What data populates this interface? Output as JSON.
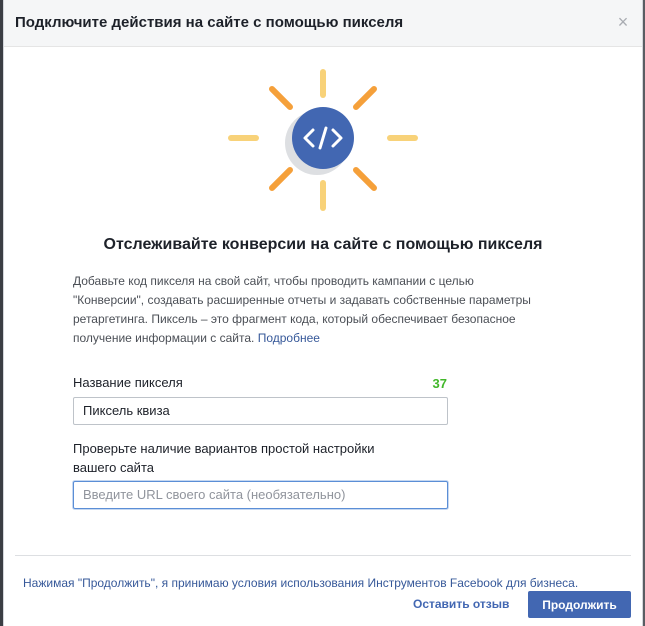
{
  "dialog": {
    "title": "Подключите действия на сайте с помощью пикселя",
    "close_glyph": "×"
  },
  "hero": {
    "icon": "code-icon",
    "icon_glyph": "</>",
    "colors": {
      "badge": "#4267b2",
      "badge_shadow": "#dddfe2",
      "ray_orange": "#f5a03a",
      "ray_yellow": "#f8d279"
    }
  },
  "main": {
    "heading": "Отслеживайте конверсии на сайте с помощью пикселя",
    "description_line1": "Добавьте код пикселя на свой сайт, чтобы проводить кампании с целью",
    "description_line2": "\"Конверсии\", создавать расширенные отчеты и задавать собственные параметры",
    "description_line3": "ретаргетинга. Пиксель – это фрагмент кода, который обеспечивает безопасное",
    "description_line4": "получение информации с сайта.",
    "learn_more": "Подробнее"
  },
  "form": {
    "pixel_name_label": "Название пикселя",
    "pixel_name_counter": "37",
    "pixel_name_value": "Пиксель квиза",
    "url_label_line1": "Проверьте наличие вариантов простой настройки",
    "url_label_line2": "вашего сайта",
    "url_placeholder": "Введите URL своего сайта (необязательно)",
    "url_value": ""
  },
  "footer": {
    "terms": "Нажимая \"Продолжить\", я принимаю условия использования Инструментов Facebook для бизнеса.",
    "feedback_label": "Оставить отзыв",
    "continue_label": "Продолжить"
  }
}
